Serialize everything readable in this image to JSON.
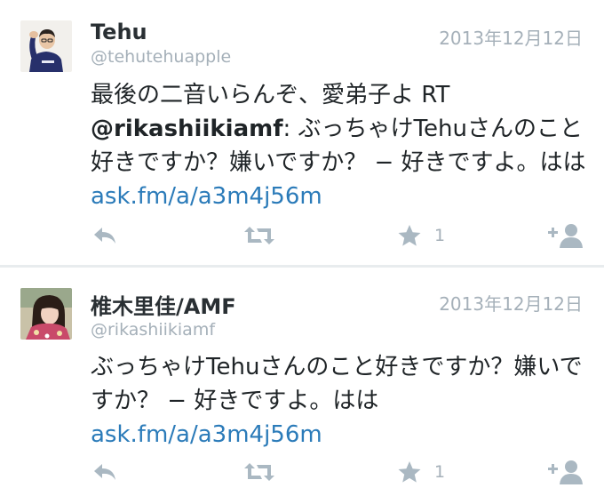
{
  "tweets": [
    {
      "name": "Tehu",
      "handle": "@tehutehuapple",
      "date": "2013年12月12日",
      "text_parts": [
        "最後の二音いらんぞ、愛弟子よ RT ",
        "@rikashiikiamf",
        ": ぶっちゃけTehuさんのこと好きですか？嫌いですか？ − 好きですよ。はは ",
        "ask.fm/a/a3m4j56m"
      ],
      "favorite_count": "1",
      "icons": [
        "reply-icon",
        "retweet-icon",
        "star-icon",
        "follow-icon"
      ]
    },
    {
      "name": "椎木里佳/AMF",
      "handle": "@rikashiikiamf",
      "date": "2013年12月12日",
      "text_parts": [
        "ぶっちゃけTehuさんのこと好きですか？嫌いですか？ − 好きですよ。はは ",
        "ask.fm/a/a3m4j56m"
      ],
      "favorite_count": "1",
      "icons": [
        "reply-icon",
        "retweet-icon",
        "star-icon",
        "follow-icon"
      ]
    }
  ],
  "colors": {
    "link": "#2b7bb9",
    "muted": "#a5b0b9",
    "icon": "#aab8c2",
    "divider": "#e8ecee"
  }
}
